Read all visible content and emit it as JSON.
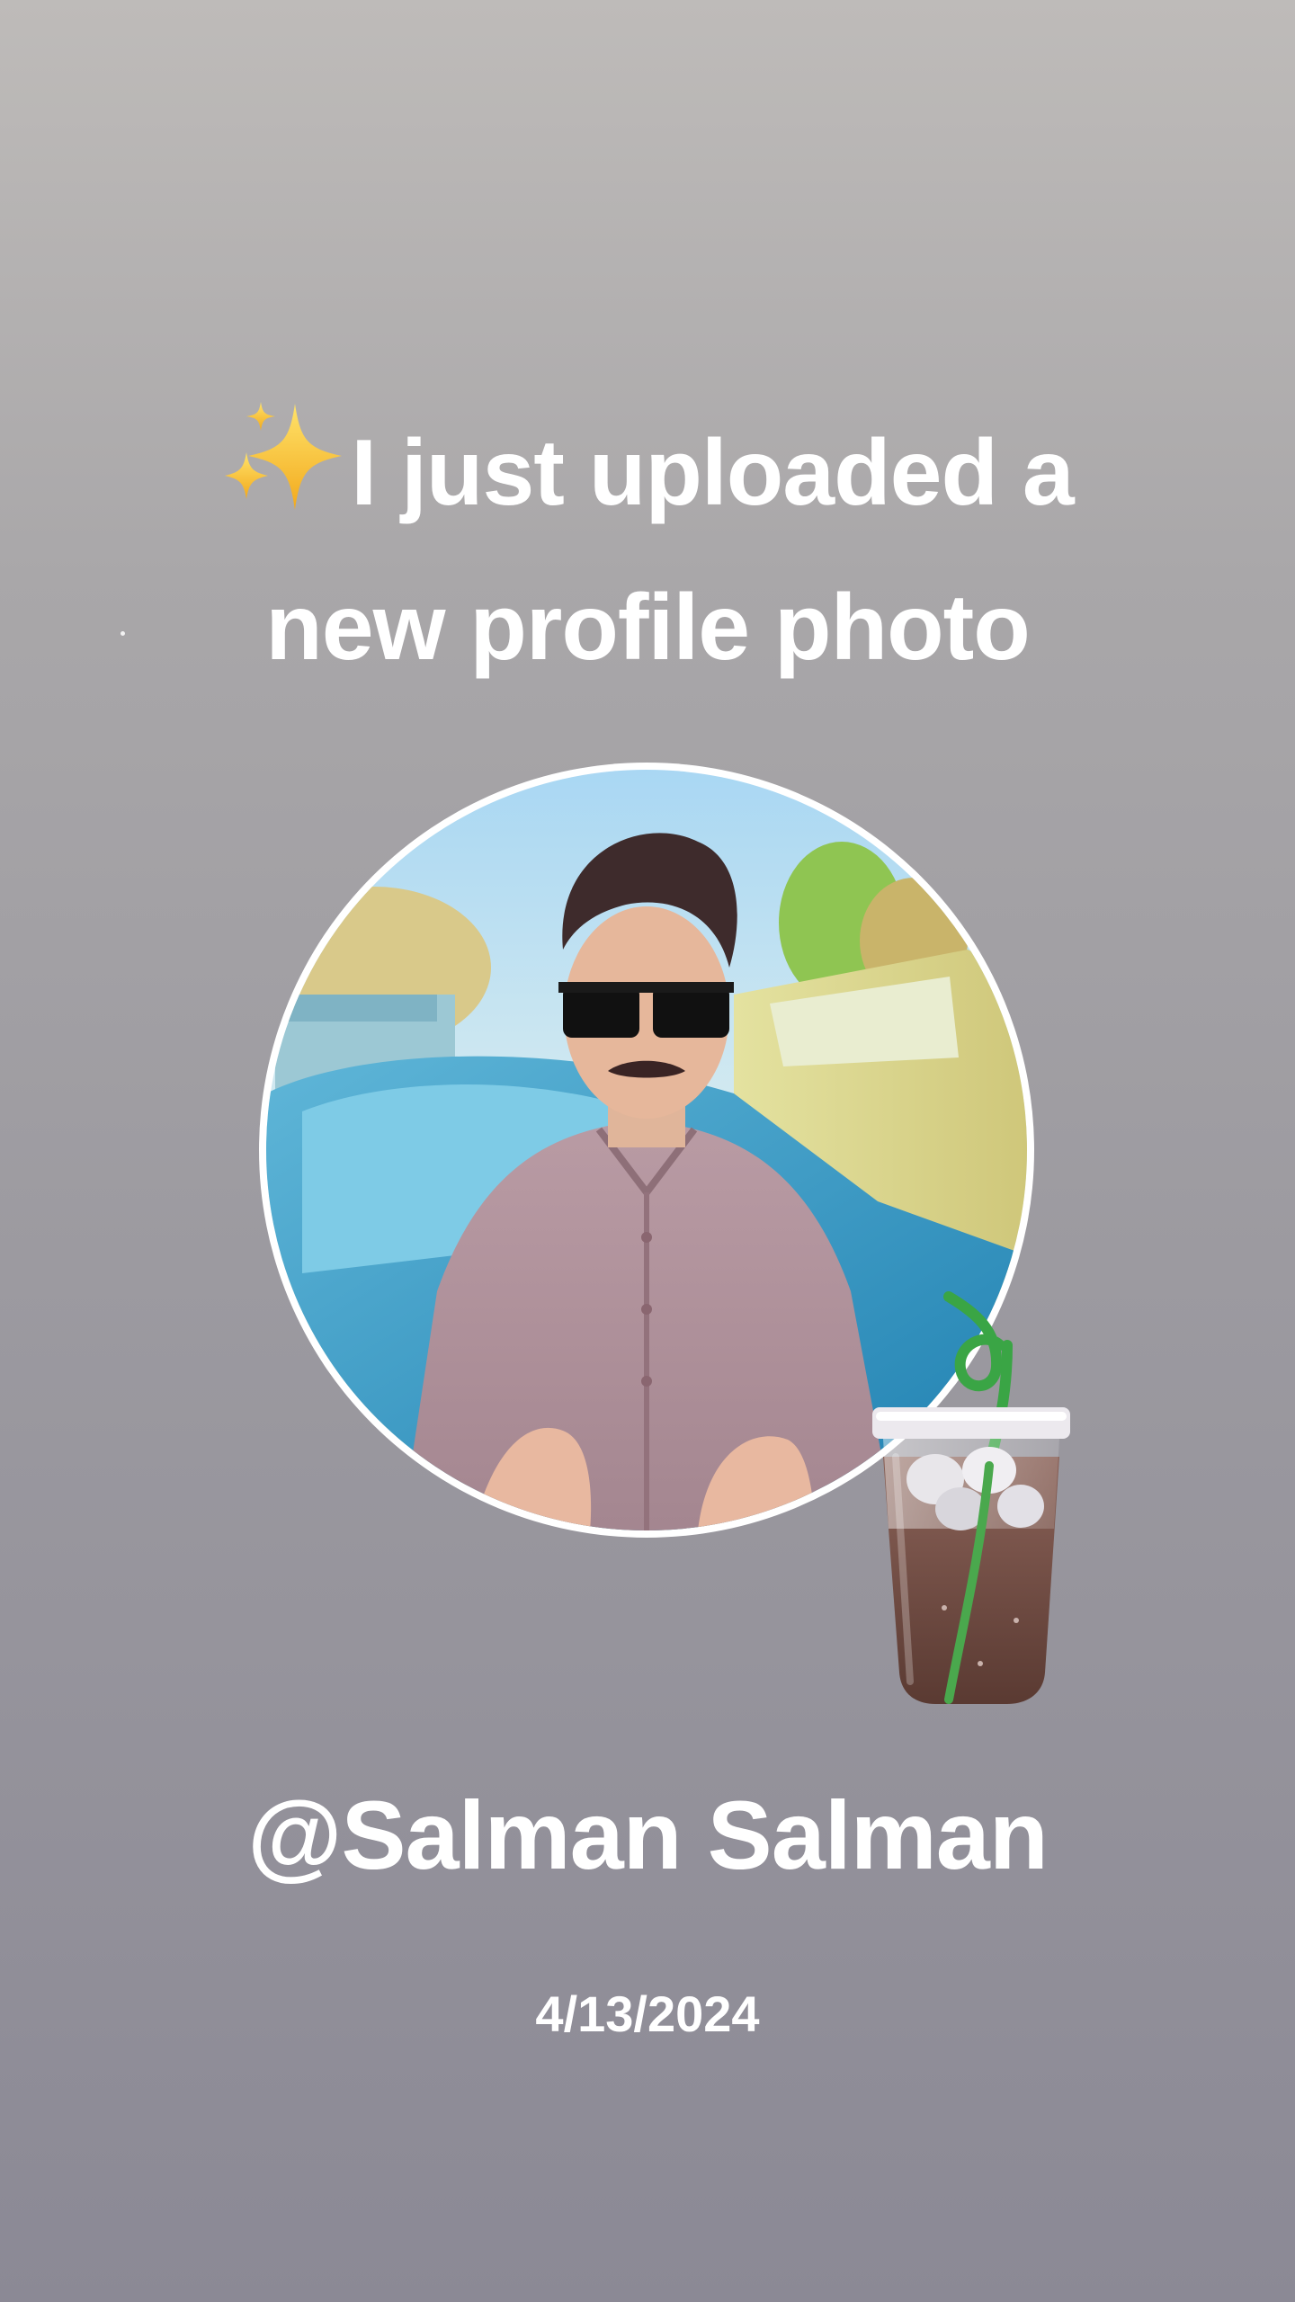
{
  "headline": {
    "line1": "I just uploaded a",
    "line2": "new profile photo",
    "leading_emoji": "sparkles-icon"
  },
  "profile": {
    "photo": "profile-photo",
    "sticker": "iced-drink-sticker"
  },
  "username": "@Salman Salman",
  "date": "4/13/2024",
  "colors": {
    "background_top": "#bebbb9",
    "background_bottom": "#8b8995",
    "text": "#ffffff",
    "ring": "#ffffff",
    "sparkle": "#f7c62f",
    "straw": "#3aa545"
  }
}
